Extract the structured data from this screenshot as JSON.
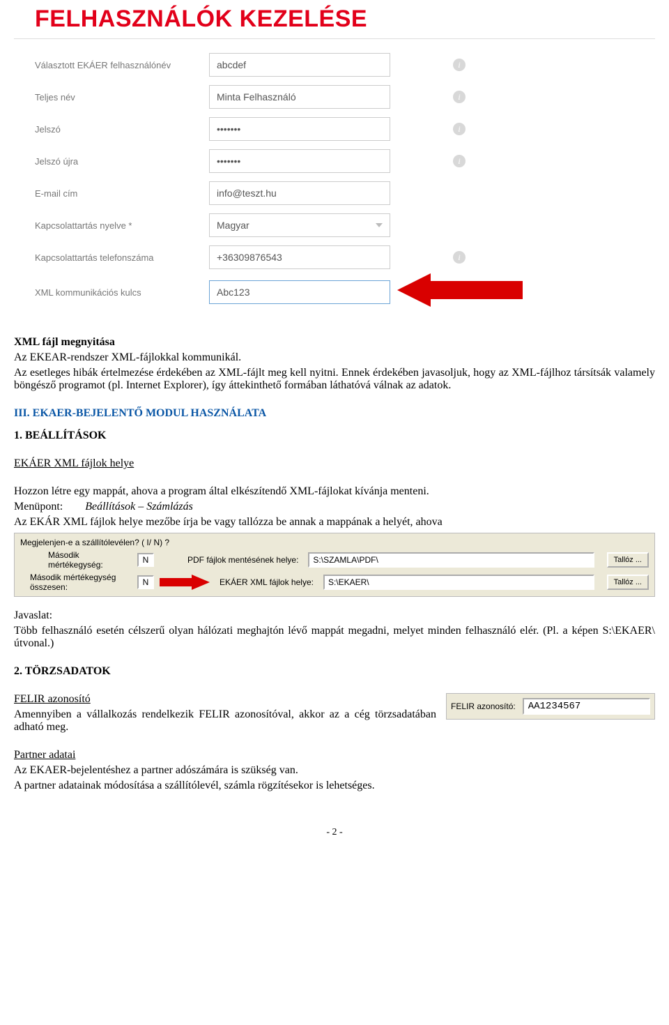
{
  "form": {
    "title": "FELHASZNÁLÓK KEZELÉSE",
    "rows": [
      {
        "label": "Választott EKÁER felhasználónév",
        "value": "abcdef",
        "info": true
      },
      {
        "label": "Teljes név",
        "value": "Minta Felhasználó",
        "info": true
      },
      {
        "label": "Jelszó",
        "value": "•••••••",
        "info": true
      },
      {
        "label": "Jelszó újra",
        "value": "•••••••",
        "info": true
      },
      {
        "label": "E-mail cím",
        "value": "info@teszt.hu",
        "info": false
      },
      {
        "label": "Kapcsolattartás nyelve *",
        "value": "Magyar",
        "info": false,
        "dropdown": true
      },
      {
        "label": "Kapcsolattartás telefonszáma",
        "value": "+36309876543",
        "info": true
      },
      {
        "label": "XML kommunikációs kulcs",
        "value": "Abc123",
        "info": false,
        "highlight": true,
        "arrow": true
      }
    ]
  },
  "doc": {
    "p1_title": "XML fájl megnyitása",
    "p1_l2": "Az EKEAR-rendszer XML-fájlokkal kommunikál.",
    "p1_l3": "Az esetleges hibák értelmezése érdekében az XML-fájlt meg kell nyitni. Ennek érdekében javasoljuk, hogy az XML-fájlhoz társítsák valamely böngésző programot (pl. Internet Explorer), így áttekinthető formában láthatóvá válnak az adatok.",
    "h3": "III. EKAER-BEJELENTŐ MODUL HASZNÁLATA",
    "s1": "1. BEÁLLÍTÁSOK",
    "s1_sub": "EKÁER XML fájlok helye",
    "s1_p1": "Hozzon létre egy mappát, ahova a program által elkészítendő XML-fájlokat kívánja menteni.",
    "s1_menu_label": "Menüpont:",
    "s1_menu_value": "Beállítások – Számlázás",
    "s1_p2": "Az EKÁR XML fájlok helye mezőbe írja be vagy tallózza be annak a mappának a helyét, ahova",
    "javaslat_label": "Javaslat:",
    "javaslat_text": "Több felhasználó esetén célszerű olyan hálózati meghajtón lévő mappát megadni, melyet minden felhasználó elér. (Pl. a képen S:\\EKAER\\ útvonal.)",
    "s2": "2. TÖRZSADATOK",
    "felir_title": "FELIR azonosító",
    "felir_text": "Amennyiben a vállalkozás rendelkezik FELIR azonosítóval, akkor az a cég törzsadatában adható meg.",
    "partner_title": "Partner adatai",
    "partner_text1": "Az EKAER-bejelentéshez a partner adószámára is szükség van.",
    "partner_text2": "A partner adatainak módosítása a szállítólevél, számla rögzítésekor is lehetséges."
  },
  "dialog": {
    "row1_label": "Megjelenjen-e a szállítólevélen? ( I/ N) ?",
    "row2_label": "Második mértékegység:",
    "row2_value": "N",
    "row2_mid": "PDF fájlok mentésének helye:",
    "row2_path": "S:\\SZAMLA\\PDF\\",
    "row3_label": "Második mértékegység összesen:",
    "row3_value": "N",
    "row4_mid": "EKÁER XML fájlok helye:",
    "row4_path": "S:\\EKAER\\",
    "browse_btn": "Tallóz ..."
  },
  "felir_box": {
    "label": "FELIR azonosító:",
    "value": "AA1234567"
  },
  "page_number": "- 2 -"
}
